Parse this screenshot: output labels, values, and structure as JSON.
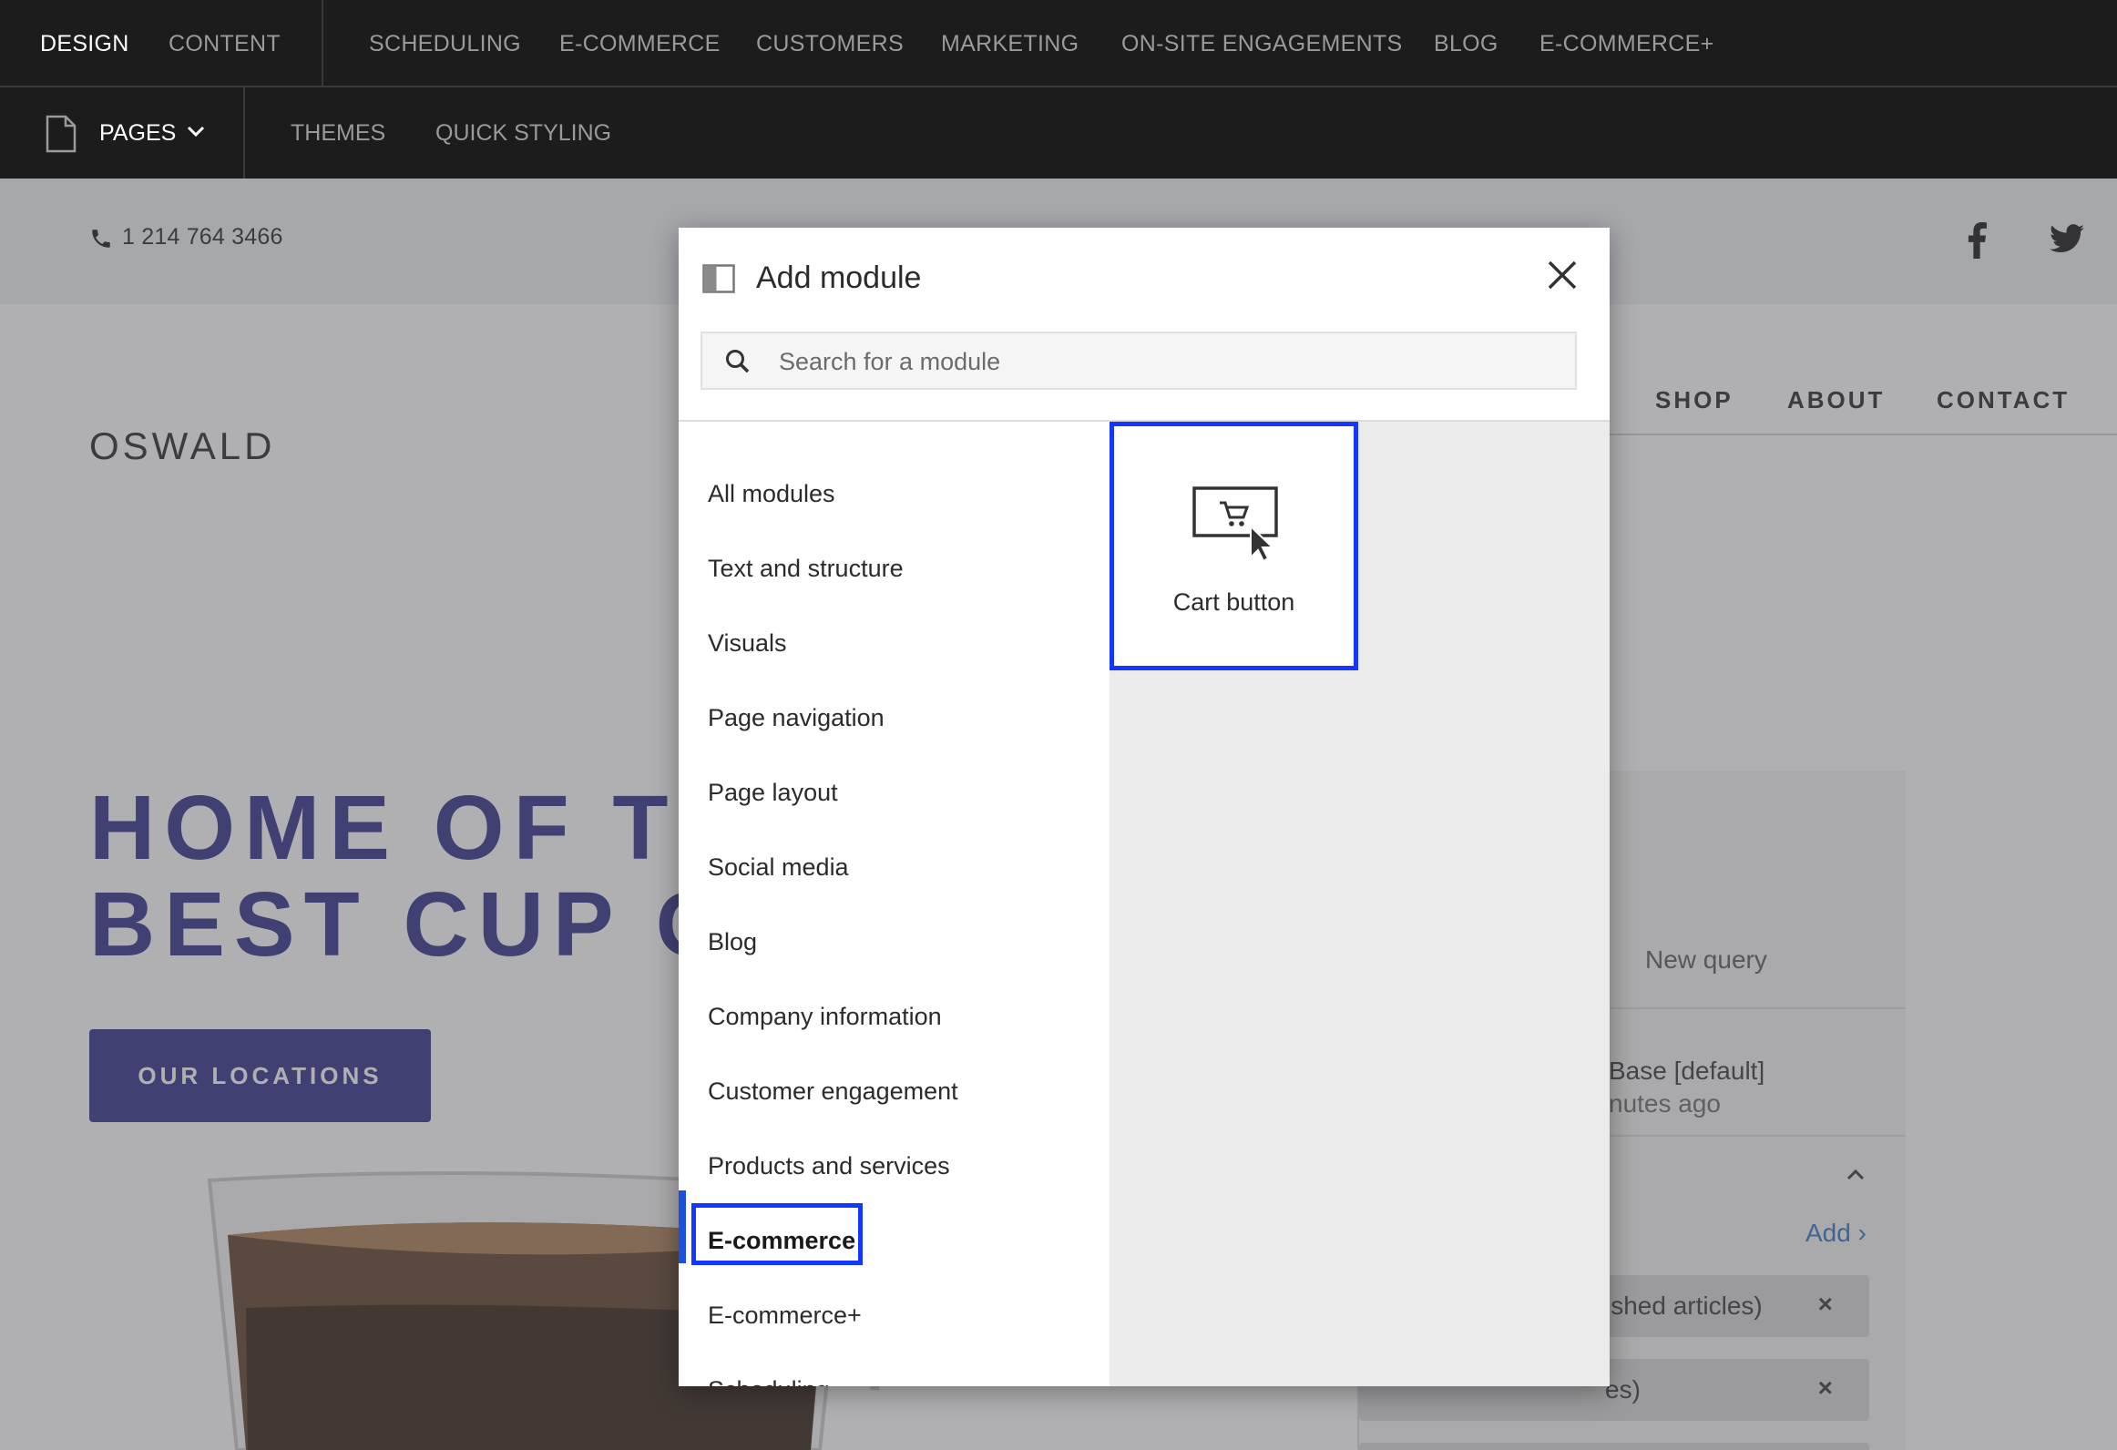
{
  "editor": {
    "top_nav": [
      "DESIGN",
      "CONTENT",
      "SCHEDULING",
      "E-COMMERCE",
      "CUSTOMERS",
      "MARKETING",
      "ON-SITE ENGAGEMENTS",
      "BLOG",
      "E-COMMERCE+"
    ],
    "active_top": "DESIGN",
    "sub_nav": {
      "pages": "PAGES",
      "themes": "THEMES",
      "quick_styling": "QUICK STYLING"
    }
  },
  "site": {
    "phone": "1 214 764 3466",
    "logo": "OSWALD",
    "nav": [
      "SHOP",
      "ABOUT",
      "CONTACT"
    ],
    "hero_line1": "HOME OF THE W",
    "hero_line2": "BEST CUP OF CO",
    "cta": "OUR LOCATIONS",
    "brand_color": "#2b2a87"
  },
  "background_panel": {
    "query": "New query",
    "base": "Base [default]",
    "time": "nutes ago",
    "add": "Add ›",
    "chips": [
      "ished articles)",
      "es)",
      ""
    ]
  },
  "modal": {
    "title": "Add module",
    "search_placeholder": "Search for a module",
    "categories": [
      "All modules",
      "Text and structure",
      "Visuals",
      "Page navigation",
      "Page layout",
      "Social media",
      "Blog",
      "Company information",
      "Customer engagement",
      "Products and services",
      "E-commerce",
      "E-commerce+",
      "Scheduling"
    ],
    "active_category": "E-commerce",
    "modules": [
      {
        "label": "Cart button",
        "icon": "cart-button-icon"
      }
    ],
    "highlight_color": "#1436ff"
  }
}
